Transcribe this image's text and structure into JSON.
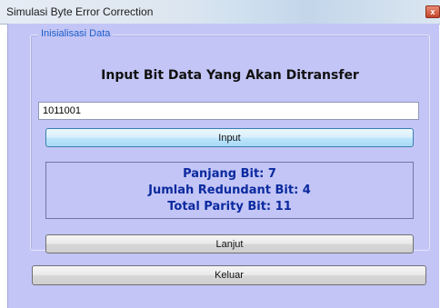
{
  "window": {
    "title": "Simulasi Byte Error Correction",
    "close_label": "x"
  },
  "group": {
    "legend": "Inisialisasi Data",
    "heading": "Input Bit Data Yang Akan Ditransfer",
    "input_value": "1011001",
    "input_button": "Input",
    "info": {
      "panjang": "Panjang Bit: 7",
      "redundant": "Jumlah Redundant Bit: 4",
      "parity": "Total Parity Bit: 11"
    },
    "lanjut_button": "Lanjut"
  },
  "footer": {
    "keluar_button": "Keluar"
  },
  "colors": {
    "form_background": "#c3c5f6",
    "info_text": "#0b2a9e",
    "legend_text": "#1d5fc9"
  }
}
